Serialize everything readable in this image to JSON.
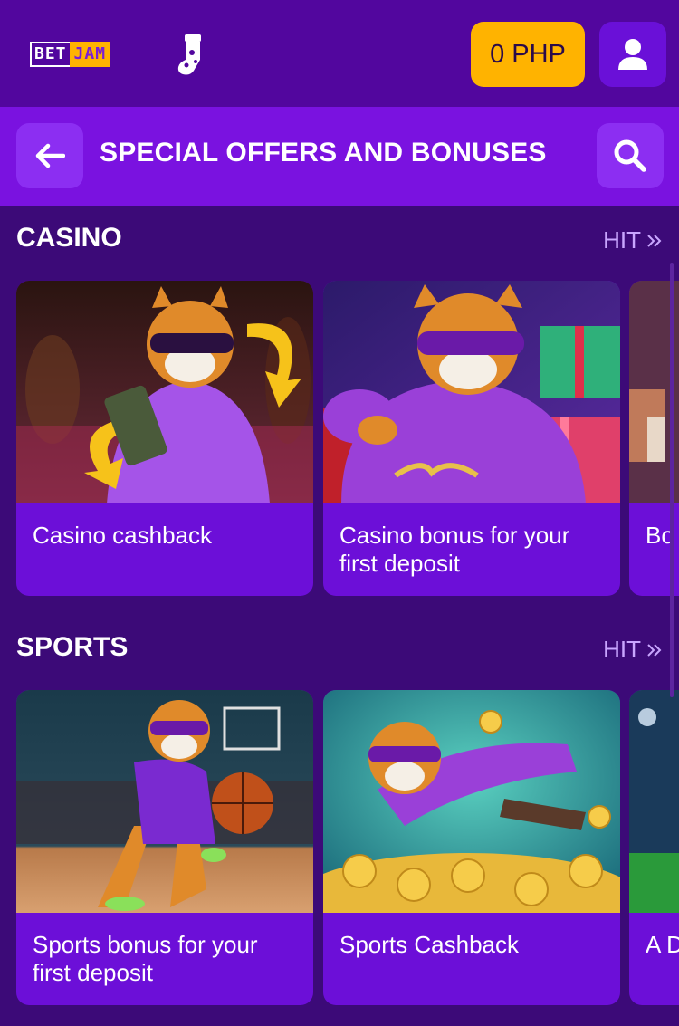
{
  "brand": {
    "logo_part1": "BET",
    "logo_part2": "JAM"
  },
  "topbar": {
    "balance": "0 PHP"
  },
  "header": {
    "title": "SPECIAL OFFERS AND BONUSES"
  },
  "sections": [
    {
      "title": "CASINO",
      "hit_label": "HIT",
      "cards": [
        {
          "label": "Casino cashback"
        },
        {
          "label": "Casino bonus for your first deposit"
        },
        {
          "label": "Bo"
        }
      ]
    },
    {
      "title": "SPORTS",
      "hit_label": "HIT",
      "cards": [
        {
          "label": "Sports bonus for your first deposit"
        },
        {
          "label": "Sports Cashback"
        },
        {
          "label": "A D"
        }
      ]
    }
  ],
  "colors": {
    "accent": "#ffb300",
    "background": "#3c0a78",
    "header": "#7a12e0",
    "card": "#6c0fd8"
  }
}
